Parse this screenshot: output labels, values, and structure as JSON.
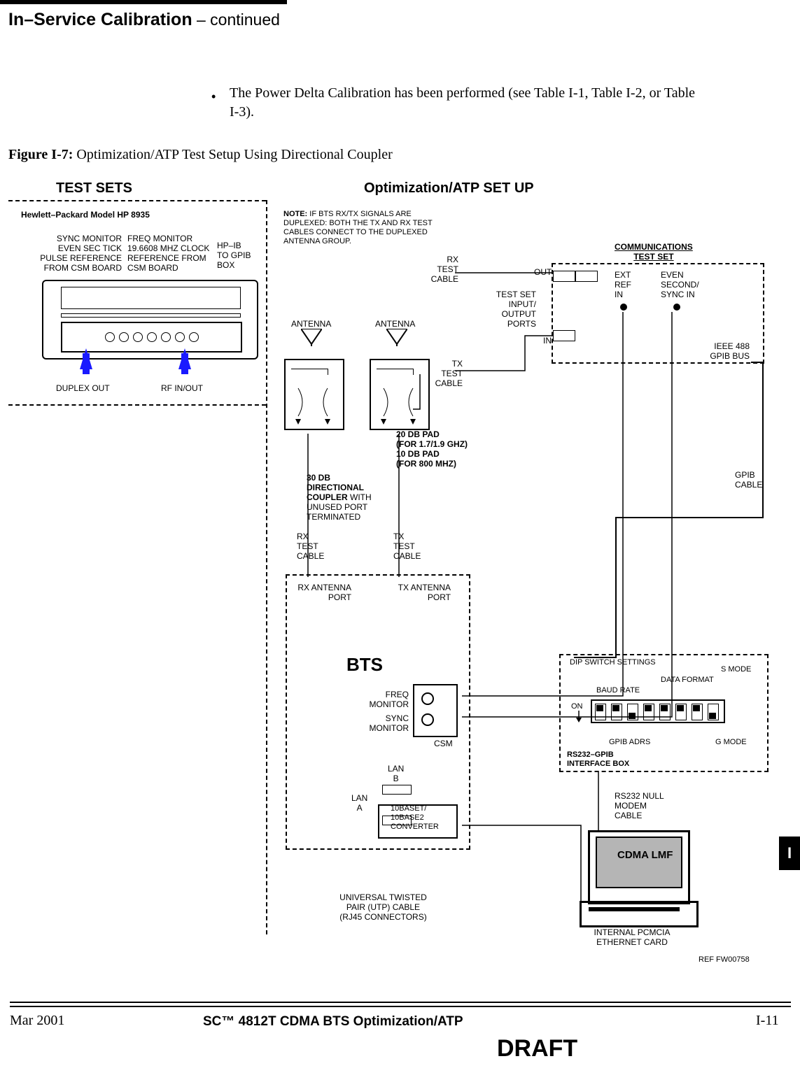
{
  "header": {
    "title_bold": "In–Service Calibration",
    "title_cont": " – continued"
  },
  "body": {
    "bullet_text": "The Power Delta Calibration has been performed (see Table I-1, Table I-2, or Table I-3)."
  },
  "figure": {
    "tag": "Figure I-7:",
    "caption": " Optimization/ATP Test Setup Using Directional Coupler",
    "section_testsets": "TEST SETS",
    "section_opt": "Optimization/ATP SET UP"
  },
  "labels": {
    "hp_model": "Hewlett–Packard Model HP 8935",
    "sync_monitor": "SYNC MONITOR\nEVEN SEC TICK\nPULSE REFERENCE\nFROM CSM BOARD",
    "freq_monitor": "FREQ MONITOR\n19.6608 MHZ CLOCK\nREFERENCE FROM\nCSM BOARD",
    "hpib": "HP–IB\nTO GPIB\nBOX",
    "duplex_out": "DUPLEX OUT",
    "rf_inout": "RF IN/OUT",
    "note_bold": "NOTE:",
    "note": "  IF BTS RX/TX SIGNALS ARE\nDUPLEXED: BOTH THE TX AND RX TEST\nCABLES CONNECT TO THE DUPLEXED\nANTENNA GROUP.",
    "comm_test_set": "COMMUNICATIONS\nTEST SET",
    "ext_ref_in": "EXT\nREF\nIN",
    "even_sync": "EVEN\nSECOND/\nSYNC IN",
    "out": "OUT",
    "in": "IN",
    "testset_ports": "TEST SET\nINPUT/\nOUTPUT\nPORTS",
    "rx_test_cable": "RX\nTEST\nCABLE",
    "tx_test_cable": "TX\nTEST\nCABLE",
    "antenna": "ANTENNA",
    "ieee488": "IEEE 488\nGPIB BUS",
    "db_pad": "20 DB PAD\n(FOR 1.7/1.9 GHZ)\n10 DB PAD\n(FOR 800 MHZ)",
    "dir_coupler1": "30 DB\nDIRECTIONAL\nCOUPLER",
    "dir_coupler2": "  WITH\nUNUSED PORT\nTERMINATED",
    "rx_antenna_port": "RX ANTENNA\nPORT",
    "tx_antenna_port": "TX ANTENNA\nPORT",
    "gpib_cable": "GPIB\nCABLE",
    "bts": "BTS",
    "freq_monitor2": "FREQ\nMONITOR",
    "sync_monitor2": "SYNC\nMONITOR",
    "csm": "CSM",
    "lan_a": "LAN\nA",
    "lan_b": "LAN\nB",
    "baset": "10BASET/\n10BASE2\nCONVERTER",
    "utp": "UNIVERSAL TWISTED\nPAIR (UTP) CABLE\n(RJ45 CONNECTORS)",
    "dip_switch": "DIP SWITCH SETTINGS",
    "s_mode": "S MODE",
    "data_format": "DATA FORMAT",
    "baud_rate": "BAUD RATE",
    "on": "ON",
    "gpib_adrs": "GPIB ADRS",
    "g_mode": "G MODE",
    "rs232_gpib": "RS232–GPIB\nINTERFACE BOX",
    "rs232_null": "RS232 NULL\nMODEM\nCABLE",
    "cdma_lmf": "CDMA\nLMF",
    "pcmcia": "INTERNAL PCMCIA\nETHERNET CARD",
    "ref": "REF FW00758"
  },
  "footer": {
    "date": "Mar 2001",
    "center": "SC™ 4812T CDMA BTS Optimization/ATP",
    "page": "I-11",
    "draft": "DRAFT",
    "side_I": "I"
  }
}
